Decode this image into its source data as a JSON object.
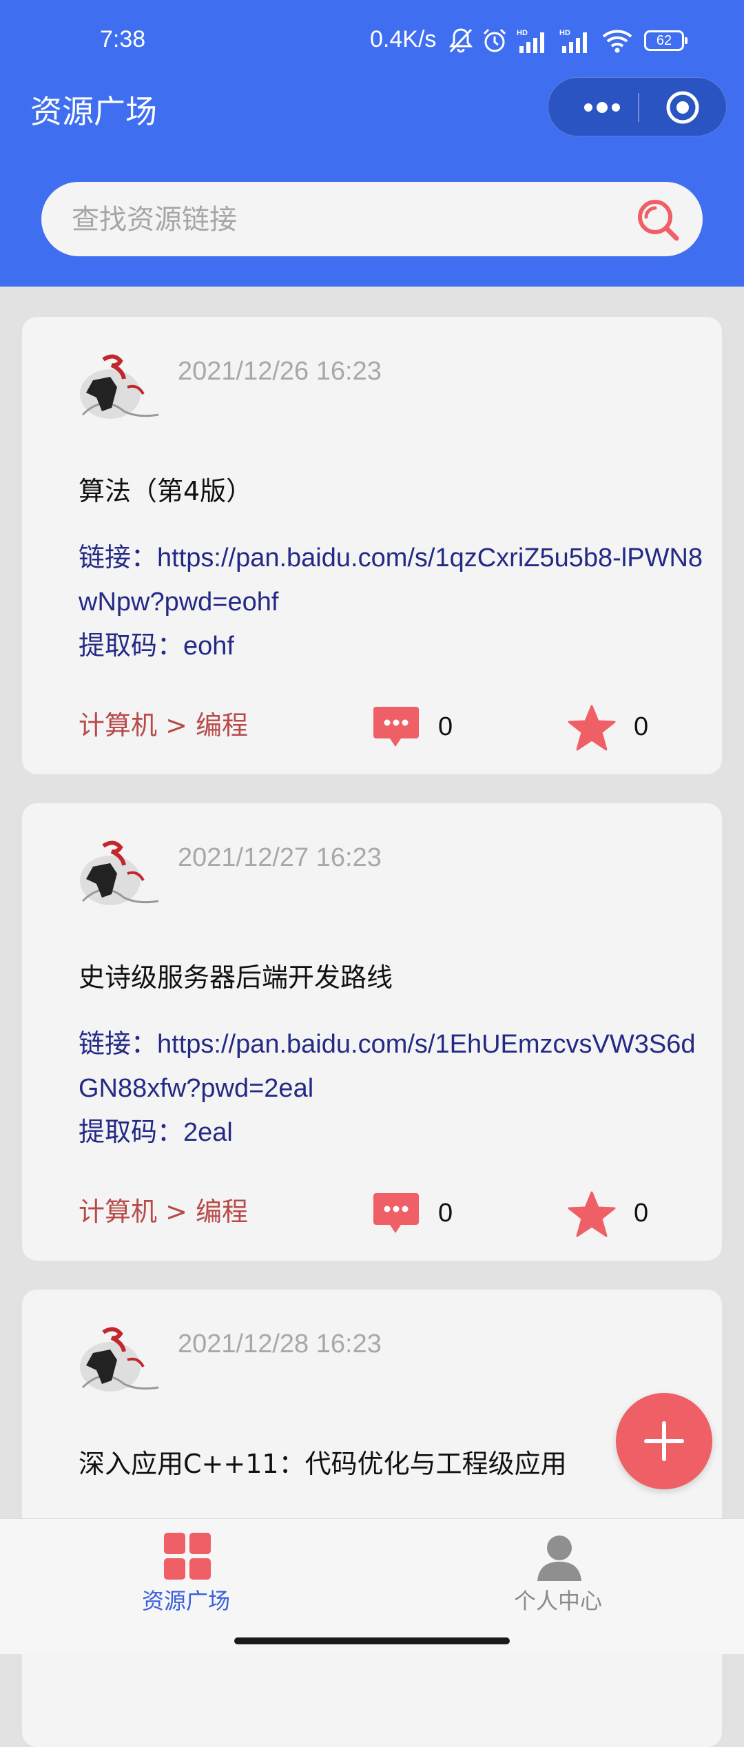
{
  "status_bar": {
    "time": "7:38",
    "net_speed": "0.4K/s",
    "battery": "62",
    "icons": [
      "bell-off-icon",
      "alarm-icon",
      "hd-signal-icon",
      "hd-signal-icon",
      "wifi-icon",
      "battery-icon"
    ]
  },
  "header": {
    "title": "资源广场",
    "capsule": {
      "more_icon": "more-dots-icon",
      "close_icon": "target-circle-icon"
    },
    "search": {
      "placeholder": "查找资源链接",
      "icon": "search-icon"
    }
  },
  "posts": [
    {
      "date": "2021/12/26 16:23",
      "title": "算法（第4版）",
      "link_label": "链接：",
      "url": "https://pan.baidu.com/s/1qzCxriZ5u5b8-lPWN8wNpw?pwd=eohf",
      "code_label": "提取码：",
      "code": "eohf",
      "category": "计算机 > 编程",
      "comments": "0",
      "stars": "0"
    },
    {
      "date": "2021/12/27 16:23",
      "title": "史诗级服务器后端开发路线",
      "link_label": "链接：",
      "url": "https://pan.baidu.com/s/1EhUEmzcvsVW3S6dGN88xfw?pwd=2eal",
      "code_label": "提取码：",
      "code": "2eal",
      "category": "计算机 > 编程",
      "comments": "0",
      "stars": "0"
    },
    {
      "date": "2021/12/28 16:23",
      "title": "深入应用C++11：代码优化与工程级应用"
    }
  ],
  "fab": {
    "icon": "plus-icon"
  },
  "tabbar": {
    "tabs": [
      {
        "label": "资源广场",
        "icon": "grid-icon",
        "active": true
      },
      {
        "label": "个人中心",
        "icon": "user-icon",
        "active": false
      }
    ]
  },
  "colors": {
    "primary": "#3f6ff0",
    "accent_red": "#ef5f66",
    "link": "#232a85",
    "category": "#b84a4a",
    "tab_active": "#3a5fd8"
  }
}
